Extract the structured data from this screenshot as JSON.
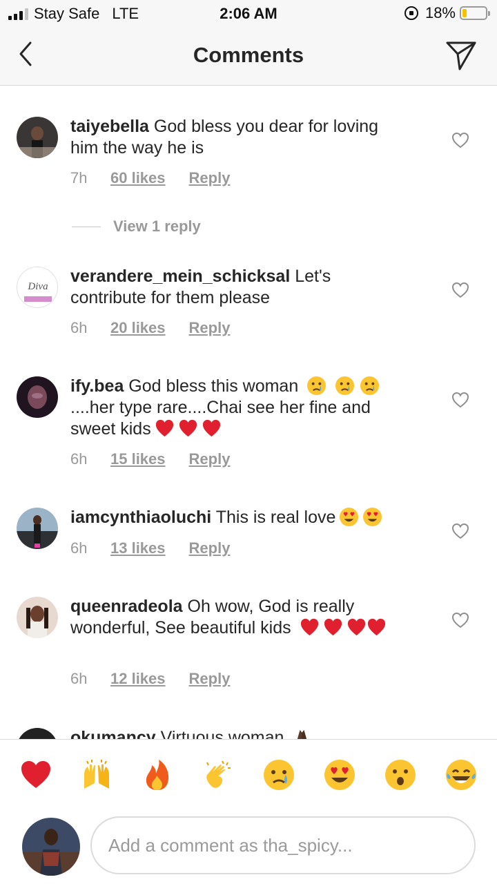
{
  "status_bar": {
    "carrier": "Stay Safe",
    "network": "LTE",
    "time": "2:06 AM",
    "battery": "18%",
    "battery_level": 0.18,
    "battery_color": "#f4c300"
  },
  "nav": {
    "title": "Comments",
    "back_icon": "chevron-left-icon",
    "share_icon": "send-icon"
  },
  "comments": [
    {
      "username": "taiyebella",
      "text": "God bless you dear for loving him the way he is",
      "time": "7h",
      "likes": "60 likes",
      "reply": "Reply",
      "view_replies": "View 1 reply"
    },
    {
      "username": "verandere_mein_schicksal",
      "text": "Let's contribute for them please",
      "time": "6h",
      "likes": "20 likes",
      "reply": "Reply",
      "avatar_text": "Diva"
    },
    {
      "username": "ify.bea",
      "text": "God bless this woman",
      "text2": "....her type rare....Chai see her fine and sweet kids",
      "time": "6h",
      "likes": "15 likes",
      "reply": "Reply"
    },
    {
      "username": "iamcynthiaoluchi",
      "text": "This is real love",
      "time": "6h",
      "likes": "13 likes",
      "reply": "Reply"
    },
    {
      "username": "queenradeola",
      "text": "Oh wow, God is really wonderful, See beautiful kids",
      "time": "6h",
      "likes": "12 likes",
      "reply": "Reply"
    },
    {
      "username": "okumancy",
      "text": "Virtuous woman"
    }
  ],
  "emoji_bar": [
    "heart-emoji",
    "raised-hands-emoji",
    "fire-emoji",
    "clapping-emoji",
    "crying-emoji",
    "heart-eyes-emoji",
    "surprised-emoji",
    "laughing-emoji"
  ],
  "composer": {
    "placeholder": "Add a comment as tha_spicy..."
  },
  "colors": {
    "text": "#262626",
    "secondary": "#999999",
    "bar_bg": "#f7f7f7",
    "heart_red": "#e0202f"
  }
}
